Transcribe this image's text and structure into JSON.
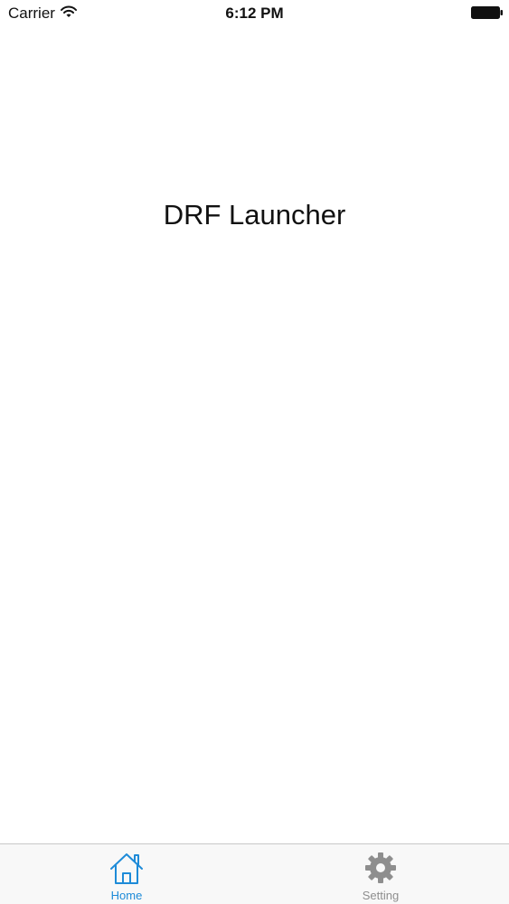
{
  "status_bar": {
    "carrier": "Carrier",
    "time": "6:12 PM",
    "icons": [
      "wifi-icon",
      "battery-icon"
    ]
  },
  "main": {
    "title": "DRF Launcher"
  },
  "tab_bar": {
    "selected": "home",
    "tabs": [
      {
        "id": "home",
        "label": "Home",
        "icon": "home-icon",
        "color": "#1e8bd8"
      },
      {
        "id": "setting",
        "label": "Setting",
        "icon": "gear-icon",
        "color": "#8e8e8e"
      }
    ]
  }
}
